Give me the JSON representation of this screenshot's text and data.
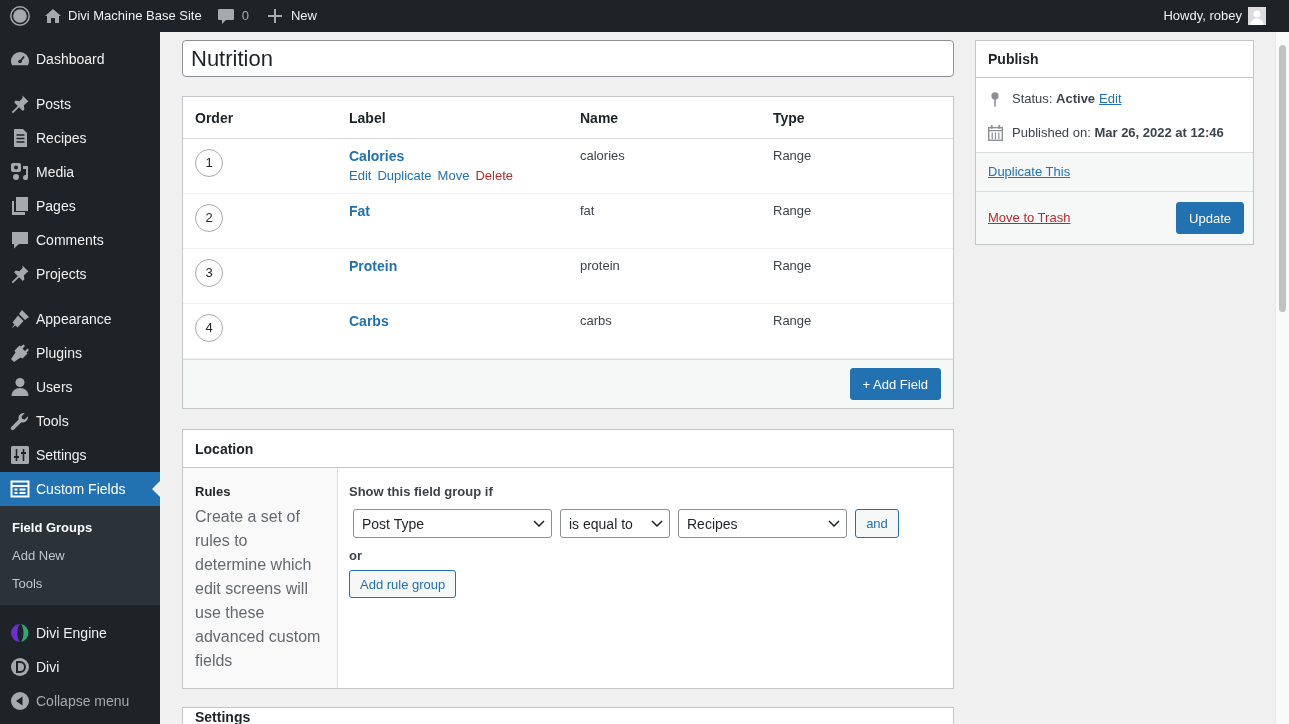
{
  "admin_bar": {
    "site_name": "Divi Machine Base Site",
    "comments_count": "0",
    "new_label": "New",
    "greeting": "Howdy, robey"
  },
  "sidebar": {
    "groups": [
      {
        "items": [
          {
            "label": "Dashboard",
            "selected": false
          }
        ]
      },
      {
        "items": [
          {
            "label": "Posts",
            "selected": false
          },
          {
            "label": "Recipes",
            "selected": false
          },
          {
            "label": "Media",
            "selected": false
          },
          {
            "label": "Pages",
            "selected": false
          },
          {
            "label": "Comments",
            "selected": false
          },
          {
            "label": "Projects",
            "selected": false
          }
        ]
      },
      {
        "items": [
          {
            "label": "Appearance",
            "selected": false
          },
          {
            "label": "Plugins",
            "selected": false
          },
          {
            "label": "Users",
            "selected": false
          },
          {
            "label": "Tools",
            "selected": false
          },
          {
            "label": "Settings",
            "selected": false
          },
          {
            "label": "Custom Fields",
            "selected": true,
            "children": [
              {
                "label": "Field Groups",
                "selected": true
              },
              {
                "label": "Add New",
                "selected": false
              },
              {
                "label": "Tools",
                "selected": false
              }
            ]
          }
        ]
      },
      {
        "items": [
          {
            "label": "Divi Engine",
            "selected": false
          },
          {
            "label": "Divi",
            "selected": false
          }
        ]
      }
    ],
    "collapse_label": "Collapse menu"
  },
  "title_field": {
    "value": "Nutrition"
  },
  "fields_table": {
    "columns": [
      "Order",
      "Label",
      "Name",
      "Type"
    ],
    "rows": [
      {
        "order": "1",
        "label": "Calories",
        "name": "calories",
        "type": "Range",
        "actions": [
          {
            "label": "Edit",
            "kind": "link"
          },
          {
            "label": "Duplicate",
            "kind": "link"
          },
          {
            "label": "Move",
            "kind": "link"
          },
          {
            "label": "Delete",
            "kind": "danger"
          }
        ]
      },
      {
        "order": "2",
        "label": "Fat",
        "name": "fat",
        "type": "Range"
      },
      {
        "order": "3",
        "label": "Protein",
        "name": "protein",
        "type": "Range"
      },
      {
        "order": "4",
        "label": "Carbs",
        "name": "carbs",
        "type": "Range"
      }
    ],
    "add_button": "+ Add Field"
  },
  "location": {
    "title": "Location",
    "rules_label": "Rules",
    "rules_description": "Create a set of rules to determine which edit screens will use these advanced custom fields",
    "condition_label": "Show this field group if",
    "rule": {
      "param": "Post Type",
      "operator": "is equal to",
      "value": "Recipes"
    },
    "and_button": "and",
    "or_label": "or",
    "add_group_button": "Add rule group"
  },
  "settings": {
    "title": "Settings"
  },
  "publish": {
    "title": "Publish",
    "status_text": "Status: **Active**",
    "status_edit": "Edit",
    "published_text": "Published on: **Mar 26, 2022 at 12:46**",
    "duplicate_link": "Duplicate This",
    "trash_link": "Move to Trash",
    "update_button": "Update"
  }
}
